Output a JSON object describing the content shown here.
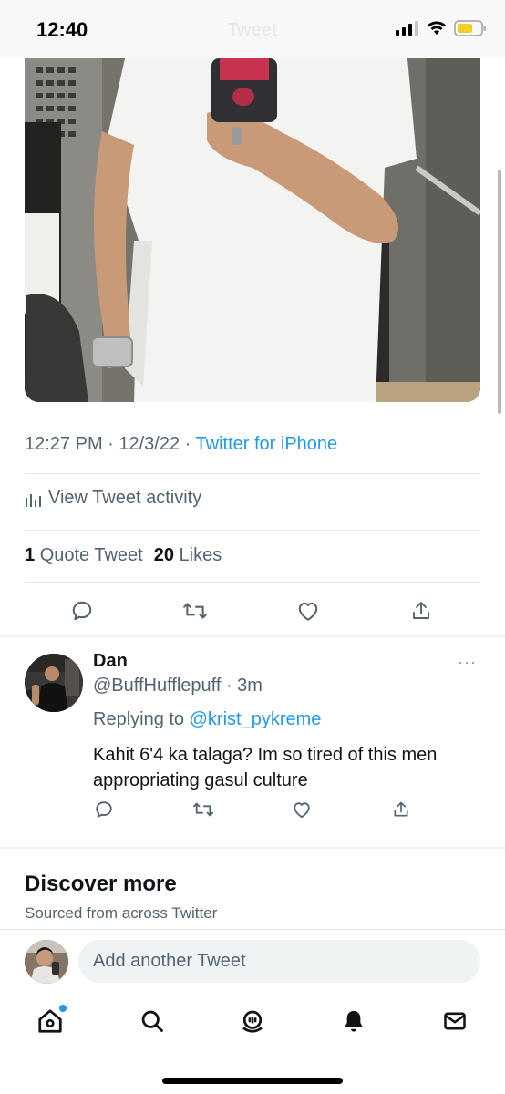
{
  "status_bar": {
    "time": "12:40",
    "ghost_title": "Tweet"
  },
  "tweet": {
    "timestamp": "12:27 PM · 12/3/22 · ",
    "source": "Twitter for iPhone",
    "activity_label": "View Tweet activity",
    "quote_count": "1",
    "quote_label": "Quote Tweet",
    "like_count": "20",
    "like_label": "Likes"
  },
  "reply": {
    "name": "Dan",
    "handle": "@BuffHufflepuff · 3m",
    "more": "···",
    "replying_prefix": "Replying to ",
    "replying_to": "@krist_pykreme",
    "text": "Kahit 6'4 ka talaga? Im so tired of this men appropriating gasul culture"
  },
  "discover": {
    "title": "Discover more",
    "subtitle": "Sourced from across Twitter"
  },
  "composer": {
    "placeholder": "Add another Tweet"
  },
  "icons": {
    "tweet_actions": [
      "reply-icon",
      "retweet-icon",
      "like-icon",
      "share-icon"
    ],
    "tabs": [
      "home-icon",
      "search-icon",
      "spaces-icon",
      "notifications-icon",
      "messages-icon"
    ]
  },
  "colors": {
    "accent": "#1d9bf0",
    "secondary_text": "#536471",
    "primary_text": "#0f1419"
  }
}
